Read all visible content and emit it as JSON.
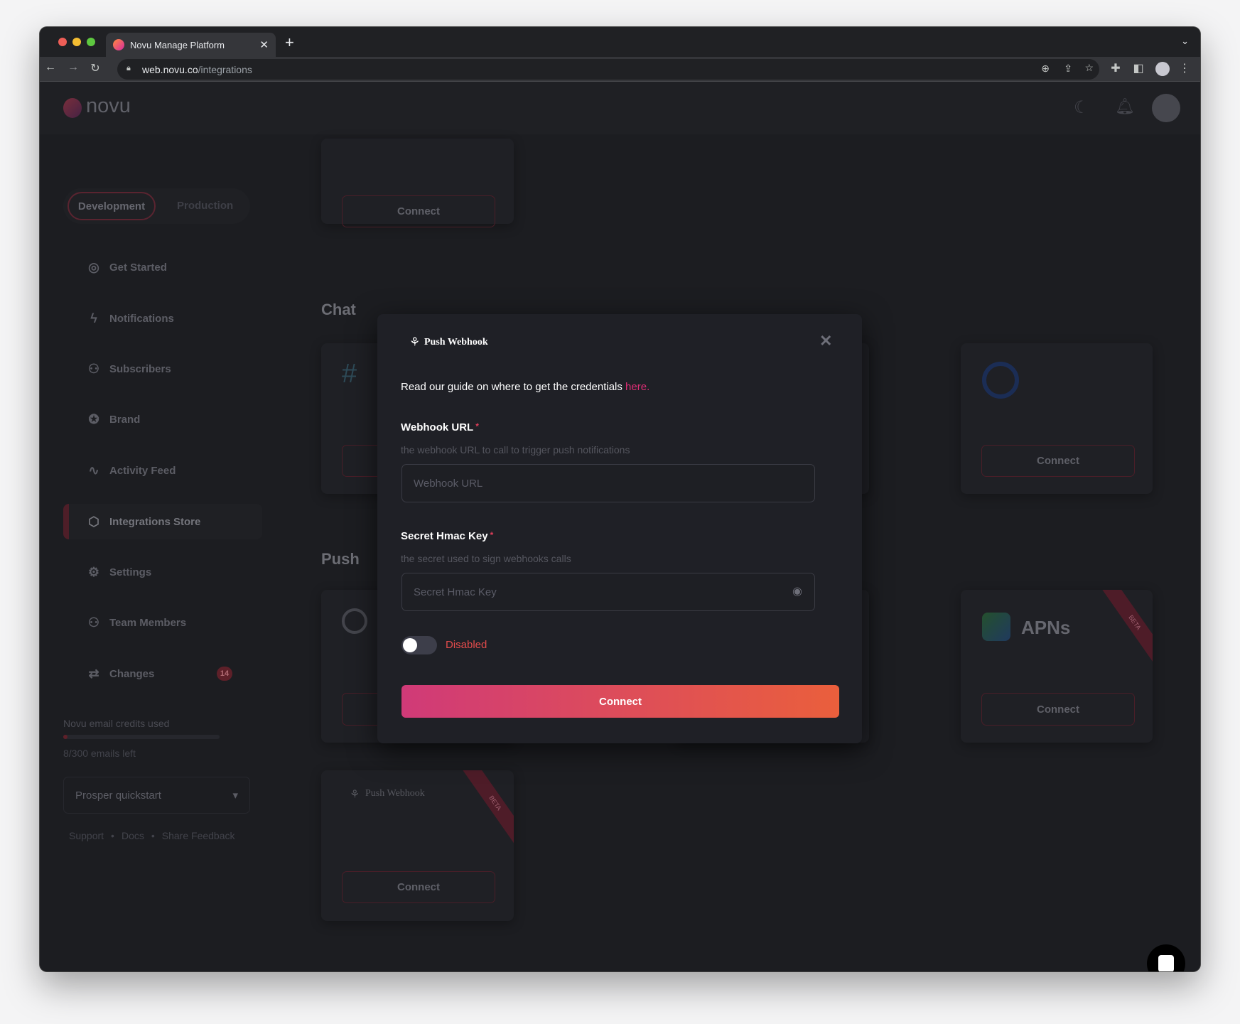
{
  "browser": {
    "tab_title": "Novu Manage Platform",
    "url_host": "web.novu.co",
    "url_path": "/integrations"
  },
  "app": {
    "logo_text": "novu",
    "environments": [
      "Development",
      "Production"
    ],
    "active_environment": "Development",
    "nav": [
      {
        "label": "Get Started",
        "icon": "check-circle-icon"
      },
      {
        "label": "Notifications",
        "icon": "bolt-icon"
      },
      {
        "label": "Subscribers",
        "icon": "users-icon"
      },
      {
        "label": "Brand",
        "icon": "badge-check-icon"
      },
      {
        "label": "Activity Feed",
        "icon": "activity-icon"
      },
      {
        "label": "Integrations Store",
        "icon": "box-icon",
        "active": true
      },
      {
        "label": "Settings",
        "icon": "gear-icon"
      },
      {
        "label": "Team Members",
        "icon": "team-icon"
      },
      {
        "label": "Changes",
        "icon": "swap-icon",
        "badge": "14"
      }
    ],
    "credits": {
      "label": "Novu email credits used",
      "used": 8,
      "total": 300,
      "left_text": "8/300 emails left"
    },
    "org_select": "Prosper quickstart",
    "footer_links": [
      "Support",
      "Docs",
      "Share Feedback"
    ]
  },
  "main": {
    "connect_label": "Connect",
    "sections": [
      {
        "title": "Chat"
      },
      {
        "title": "Push"
      }
    ],
    "apns_label": "APNs",
    "push_webhook_card": "Push Webhook",
    "beta_label": "BETA"
  },
  "modal": {
    "title": "Push Webhook",
    "guide_text": "Read our guide on where to get the credentials",
    "guide_link": "here.",
    "fields": [
      {
        "label": "Webhook URL",
        "required_mark": "*",
        "description": "the webhook URL to call to trigger push notifications",
        "placeholder": "Webhook URL",
        "value": ""
      },
      {
        "label": "Secret Hmac Key",
        "required_mark": "*",
        "description": "the secret used to sign webhooks calls",
        "placeholder": "Secret Hmac Key",
        "value": ""
      }
    ],
    "toggle_label": "Disabled",
    "toggle_on": false,
    "submit_label": "Connect",
    "colors": {
      "gradient_start": "#d03a78",
      "gradient_end": "#ea5f3c",
      "link": "#dd2e75",
      "disabled": "#e24b4b"
    }
  }
}
